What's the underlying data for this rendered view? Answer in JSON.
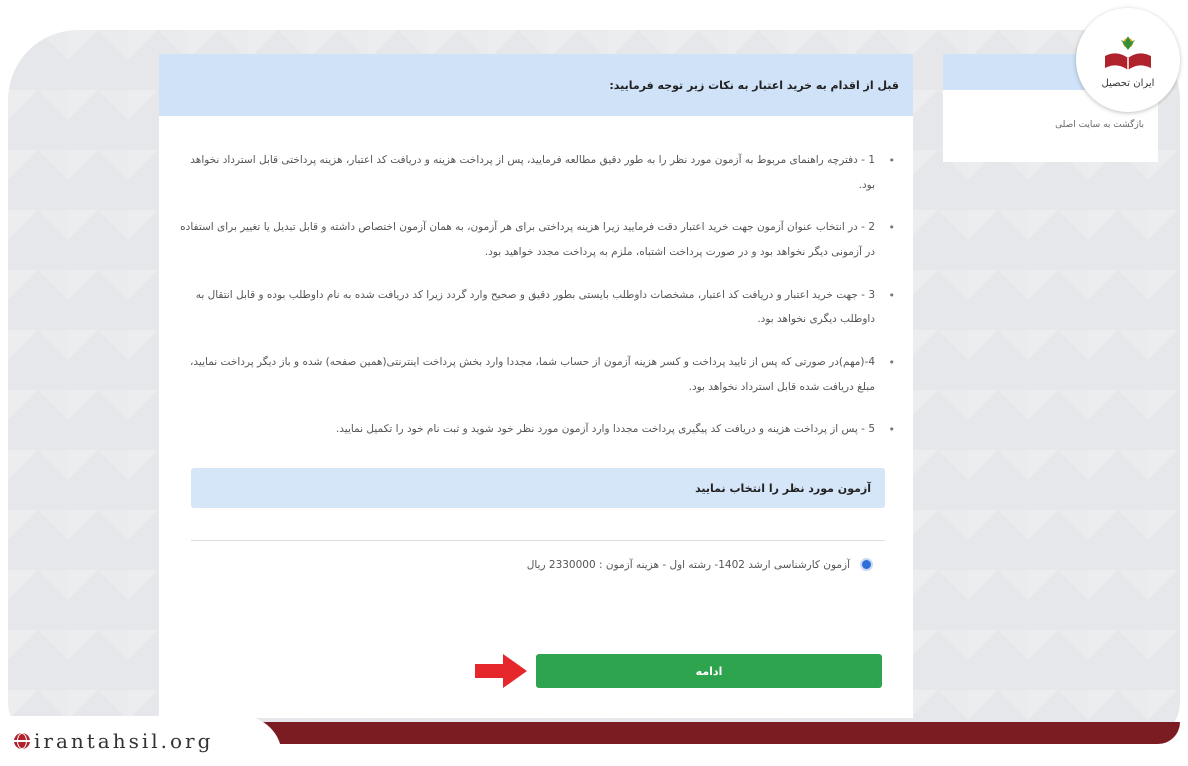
{
  "main": {
    "header": "قبل از اقدام به خرید اعتبار به نکات زیر توجه فرمایید:",
    "rules": [
      "1 - دفترچه راهنمای مربوط به آزمون مورد نظر را به طور دقیق مطالعه فرمایید، پس از پرداخت هزینه و دریافت کد اعتبار، هزینه پرداختی قابل استرداد نخواهد بود.",
      "2 - در انتخاب عنوان آزمون جهت خرید اعتبار دقت فرمایید زیرا هزینه پرداختی برای هر آزمون، به همان آزمون اختصاص داشته و قابل تبدیل یا تغییر برای استفاده در آزمونی دیگر نخواهد بود و در صورت پرداخت اشتباه، ملزم به پرداخت مجدد خواهید بود.",
      "3 - جهت خرید اعتبار و دریافت کد اعتبار، مشخصات داوطلب بایستی بطور دقیق و صحیح وارد گردد زیرا کد دریافت شده به نام داوطلب بوده و قابل انتقال به داوطلب دیگری نخواهد بود.",
      "4-(مهم)در صورتی که پس از تایید پرداخت و کسر هزینه آزمون از حساب شما، مجددا وارد بخش پرداخت اینترنتی(همین صفحه) شده و باز دیگر پرداخت نمایید، مبلغ دریافت شده قابل استرداد نخواهد بود.",
      "5 - پس از پرداخت هزینه و دریافت کد پیگیری پرداخت مجددا وارد آزمون مورد نظر خود شوید و ثبت نام خود را تکمیل نمایید."
    ],
    "select_title": "آزمون مورد نظر را انتخاب نمایید",
    "exam_option": "آزمون کارشناسی ارشد 1402- رشته اول - هزینه آزمون : 2330000 ریال",
    "continue_label": "ادامه"
  },
  "side": {
    "link": "بازگشت به سایت اصلی"
  },
  "logo": {
    "text": "ایران تحصیل"
  },
  "watermark": {
    "text": "irantahsil.org"
  },
  "colors": {
    "header_bg": "#cfe2f7",
    "continue_bg": "#2ea44f",
    "arrow": "#e5262a",
    "bottom_strip": "#7a1c22",
    "radio": "#2d6fd6"
  }
}
